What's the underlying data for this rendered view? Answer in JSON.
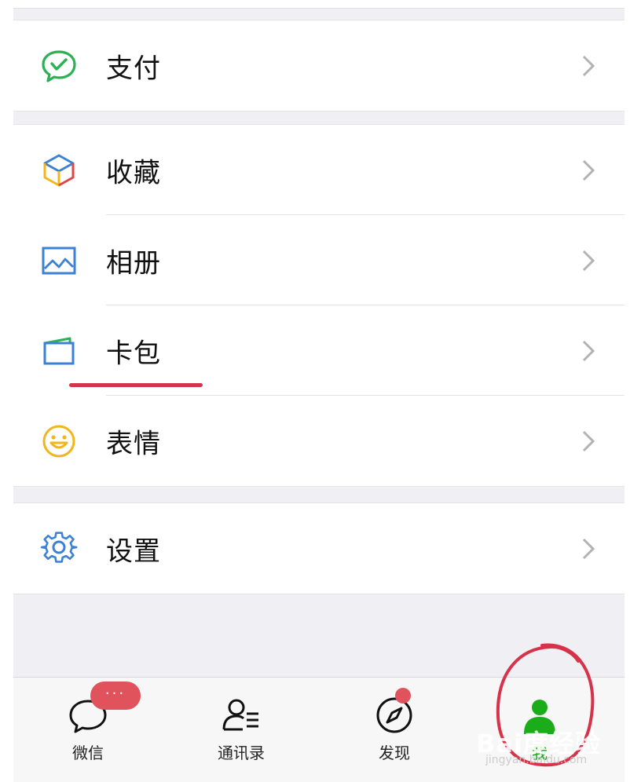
{
  "menu": {
    "pay": {
      "label": "支付",
      "icon": "wechat-pay-icon"
    },
    "favorites": {
      "label": "收藏",
      "icon": "favorites-cube-icon"
    },
    "album": {
      "label": "相册",
      "icon": "photo-album-icon"
    },
    "cards": {
      "label": "卡包",
      "icon": "card-wallet-icon"
    },
    "stickers": {
      "label": "表情",
      "icon": "smiley-icon"
    },
    "settings": {
      "label": "设置",
      "icon": "gear-icon"
    }
  },
  "tabbar": {
    "chats": {
      "label": "微信",
      "badge": "···"
    },
    "contacts": {
      "label": "通讯录"
    },
    "discover": {
      "label": "发现"
    },
    "me": {
      "label": "我"
    }
  },
  "watermark": {
    "text": "Bai度经验",
    "sub": "jingyan.baidu.com"
  },
  "colors": {
    "accent_green": "#1aad19",
    "badge_red": "#e0535c",
    "annotation_red": "#d6334a"
  }
}
